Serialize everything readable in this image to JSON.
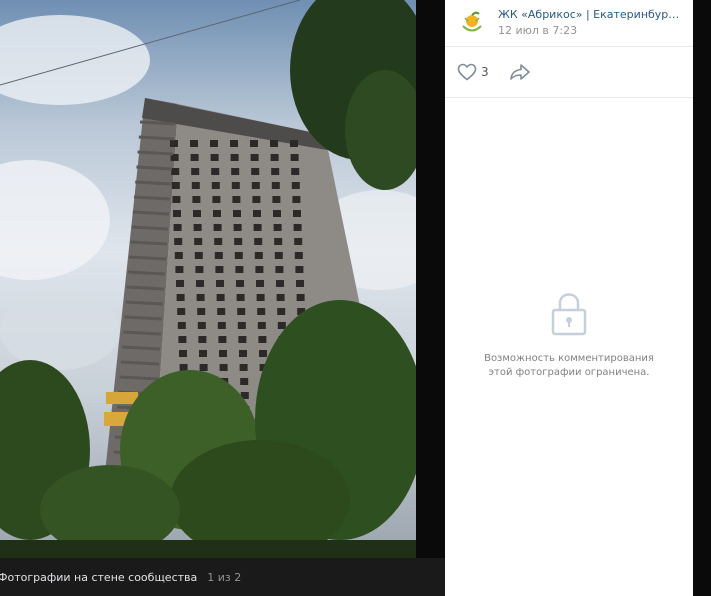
{
  "photo_viewer": {
    "album_label": "Фотографии на стене сообщества",
    "counter": "1 из 2"
  },
  "post": {
    "author": "ЖК «Абрикос» | Екатеринбург | Стр...",
    "date": "12 июл в 7:23",
    "likes": "3"
  },
  "comments": {
    "restricted_text": "Возможность комментирования этой фотографии ограничена."
  },
  "colors": {
    "link": "#2a5885",
    "muted": "#939393",
    "viewer_bg": "#0a0a0a"
  },
  "icons": [
    "heart-icon",
    "share-icon",
    "lock-icon",
    "avatar-logo"
  ]
}
